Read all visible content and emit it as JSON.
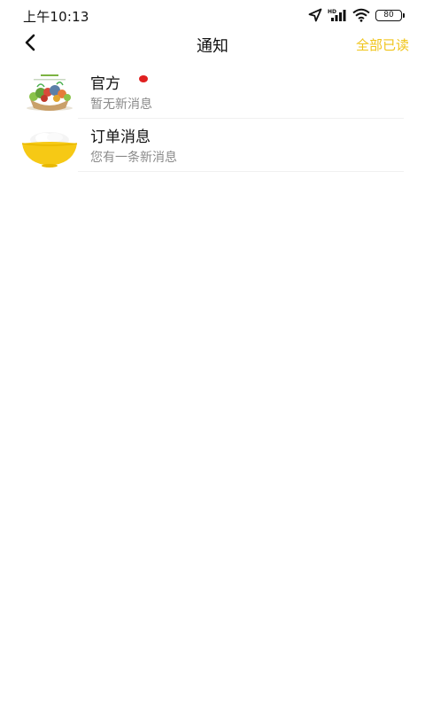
{
  "status_bar": {
    "time": "上午10:13",
    "battery": "80",
    "icons": [
      "location-arrow-icon",
      "signal-icon",
      "wifi-icon",
      "battery-icon"
    ]
  },
  "nav": {
    "back_icon": "chevron-left-icon",
    "title": "通知",
    "mark_all_read": "全部已读",
    "accent_color": "#f0c419"
  },
  "messages": [
    {
      "title": "官方",
      "subtitle": "暂无新消息",
      "unread": true,
      "icon": "vegetable-basket-thumbnail"
    },
    {
      "title": "订单消息",
      "subtitle": "您有一条新消息",
      "unread": false,
      "icon": "rice-bowl-thumbnail"
    }
  ],
  "colors": {
    "unread_dot": "#e02020",
    "subtitle": "#8a8a8a"
  }
}
